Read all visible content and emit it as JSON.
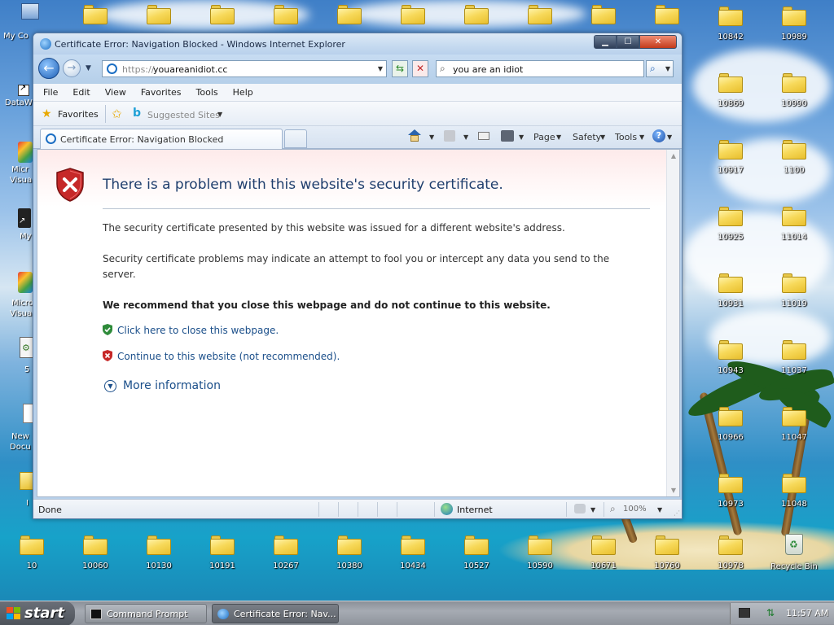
{
  "desktop": {
    "right_icons": [
      {
        "label": "10842"
      },
      {
        "label": "10989"
      },
      {
        "label": "10869"
      },
      {
        "label": "10990"
      },
      {
        "label": "10917"
      },
      {
        "label": "1100"
      },
      {
        "label": "10925"
      },
      {
        "label": "11014"
      },
      {
        "label": "10931"
      },
      {
        "label": "11019"
      },
      {
        "label": "10943"
      },
      {
        "label": "11037"
      },
      {
        "label": "10966"
      },
      {
        "label": "11047"
      },
      {
        "label": "10973"
      },
      {
        "label": "11048"
      }
    ],
    "bottom_icons": [
      {
        "label": "10"
      },
      {
        "label": "10060"
      },
      {
        "label": "10130"
      },
      {
        "label": "10191"
      },
      {
        "label": "10267"
      },
      {
        "label": "10380"
      },
      {
        "label": "10434"
      },
      {
        "label": "10527"
      },
      {
        "label": "10590"
      },
      {
        "label": "10671"
      },
      {
        "label": "10760"
      },
      {
        "label": "10978"
      }
    ],
    "recycle_bin_label": "Recycle Bin",
    "left_partial_labels": [
      "My Co",
      "DataW",
      "Micr",
      "Visua",
      "My",
      "Micro",
      "Visua",
      "5",
      "New",
      "Docu",
      "I"
    ]
  },
  "window": {
    "title": "Certificate Error: Navigation Blocked - Windows Internet Explorer",
    "buttons": {
      "minimize": "▁",
      "maximize": "☐",
      "close": "✕"
    }
  },
  "address_bar": {
    "url_prefix": "https://",
    "url_host": "youareanidiot.cc"
  },
  "search_bar": {
    "value": "you are an idiot"
  },
  "menu": {
    "items": [
      "File",
      "Edit",
      "View",
      "Favorites",
      "Tools",
      "Help"
    ]
  },
  "favorites_bar": {
    "favorites_label": "Favorites",
    "suggested_sites_label": "Suggested Sites"
  },
  "tabs": {
    "active_tab_label": "Certificate Error: Navigation Blocked"
  },
  "command_bar": {
    "page_label": "Page",
    "safety_label": "Safety",
    "tools_label": "Tools"
  },
  "error_page": {
    "title": "There is a problem with this website's security certificate.",
    "paragraph1": "The security certificate presented by this website was issued for a different website's address.",
    "paragraph2": "Security certificate problems may indicate an attempt to fool you or intercept any data you send to the server.",
    "recommendation": "We recommend that you close this webpage and do not continue to this website.",
    "close_link": "Click here to close this webpage.",
    "continue_link": "Continue to this website (not recommended).",
    "more_info": "More information"
  },
  "status_bar": {
    "status": "Done",
    "zone": "Internet",
    "zoom": "100%"
  },
  "taskbar": {
    "start_label": "start",
    "tasks": [
      {
        "label": "Command Prompt"
      },
      {
        "label": "Certificate Error: Nav..."
      }
    ],
    "clock": "11:57 AM"
  },
  "colors": {
    "link": "#1b4f8a",
    "title_text": "#1f3f6e",
    "shield_red": "#c62828",
    "shield_green": "#2e8b3a"
  }
}
